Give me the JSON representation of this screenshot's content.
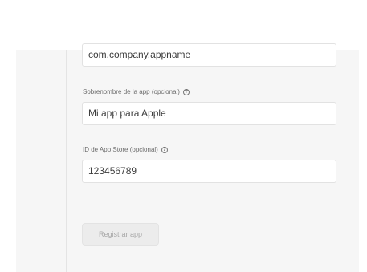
{
  "form": {
    "bundle_id": {
      "value": "com.company.appname"
    },
    "nickname": {
      "label": "Sobrenombre de la app (opcional)",
      "value": "Mi app para Apple",
      "help_icon": "question-circle-icon"
    },
    "app_store_id": {
      "label": "ID de App Store (opcional)",
      "value": "123456789",
      "help_icon": "question-circle-icon"
    },
    "submit_label": "Registrar app"
  },
  "colors": {
    "panel_background": "#f6f6f6",
    "input_border": "#e2e2e2",
    "button_background_disabled": "#ececec",
    "button_text_disabled": "#a8a8a8"
  }
}
